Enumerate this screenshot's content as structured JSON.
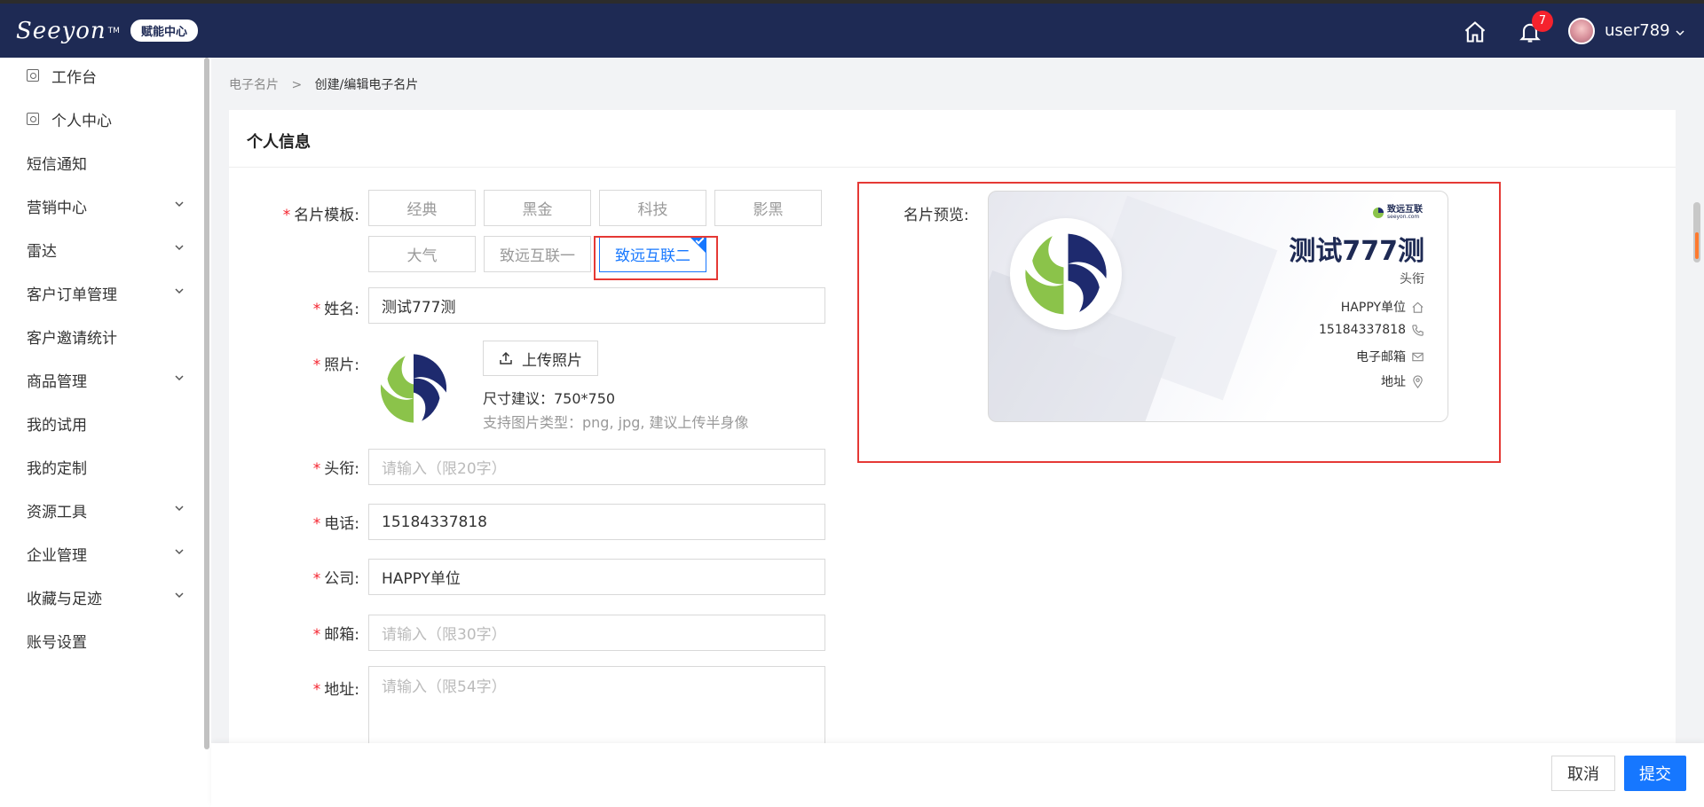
{
  "header": {
    "logo": "Seeyon",
    "logo_tm": "TM",
    "badge": "赋能中心",
    "notification_count": "7",
    "username": "user789"
  },
  "sidebar": {
    "items": [
      {
        "label": "工作台",
        "icon": "page-icon",
        "expandable": false
      },
      {
        "label": "个人中心",
        "icon": "page-icon",
        "expandable": false
      },
      {
        "label": "短信通知",
        "expandable": false
      },
      {
        "label": "营销中心",
        "expandable": true
      },
      {
        "label": "雷达",
        "expandable": true
      },
      {
        "label": "客户订单管理",
        "expandable": true
      },
      {
        "label": "客户邀请统计",
        "expandable": false
      },
      {
        "label": "商品管理",
        "expandable": true
      },
      {
        "label": "我的试用",
        "expandable": false
      },
      {
        "label": "我的定制",
        "expandable": false
      },
      {
        "label": "资源工具",
        "expandable": true
      },
      {
        "label": "企业管理",
        "expandable": true
      },
      {
        "label": "收藏与足迹",
        "expandable": true
      },
      {
        "label": "账号设置",
        "expandable": false
      }
    ]
  },
  "breadcrumb": {
    "parent": "电子名片",
    "separator": ">",
    "current": "创建/编辑电子名片"
  },
  "panel": {
    "title": "个人信息"
  },
  "form": {
    "template_label": "名片模板:",
    "templates": [
      "经典",
      "黑金",
      "科技",
      "影黑",
      "大气",
      "致远互联一",
      "致远互联二"
    ],
    "selected_template": "致远互联二",
    "name_label": "姓名:",
    "name_value": "测试777测",
    "photo_label": "照片:",
    "upload_label": "上传照片",
    "size_hint": "尺寸建议：750*750",
    "type_hint": "支持图片类型：png, jpg, 建议上传半身像",
    "title_label": "头衔:",
    "title_placeholder": "请输入（限20字）",
    "phone_label": "电话:",
    "phone_value": "15184337818",
    "company_label": "公司:",
    "company_value": "HAPPY单位",
    "email_label": "邮箱:",
    "email_placeholder": "请输入（限30字）",
    "address_label": "地址:",
    "address_placeholder": "请输入（限54字）"
  },
  "preview": {
    "label": "名片预览:",
    "brand": "致远互联",
    "brand_sub": "seeyon.com",
    "name": "测试777测",
    "title": "头衔",
    "company": "HAPPY单位",
    "phone": "15184337818",
    "email": "电子邮箱",
    "address": "地址"
  },
  "actions": {
    "cancel": "取消",
    "submit": "提交"
  },
  "colors": {
    "header_bg": "#1e2a54",
    "accent": "#1677ff",
    "required": "#f5222d",
    "highlight_box": "#e53935"
  }
}
